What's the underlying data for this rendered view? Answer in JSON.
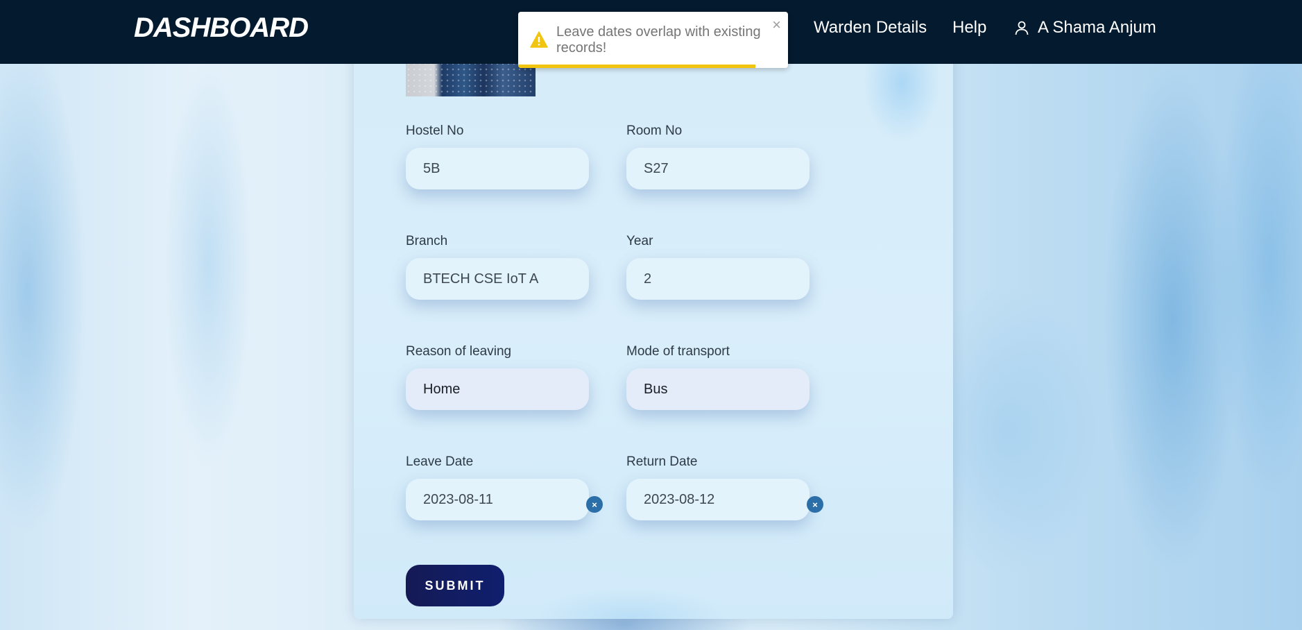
{
  "nav": {
    "brand": "DASHBOARD",
    "links": [
      "Warden Details",
      "Help"
    ],
    "user_name": "A Shama Anjum",
    "user_icon": "user-icon"
  },
  "toast": {
    "message": "Leave dates overlap with existing records!",
    "icon": "warning-icon",
    "close_label": "×",
    "progress": 0.88,
    "accent": "#f1c40f"
  },
  "form": {
    "hostel_no": {
      "label": "Hostel No",
      "value": "5B"
    },
    "room_no": {
      "label": "Room No",
      "value": "S27"
    },
    "branch": {
      "label": "Branch",
      "value": "BTECH CSE IoT A"
    },
    "year": {
      "label": "Year",
      "value": "2"
    },
    "reason": {
      "label": "Reason of leaving",
      "value": "Home"
    },
    "transport": {
      "label": "Mode of transport",
      "value": "Bus"
    },
    "leave_date": {
      "label": "Leave Date",
      "value": "2023-08-11",
      "clear_label": "×"
    },
    "return_date": {
      "label": "Return Date",
      "value": "2023-08-12",
      "clear_label": "×"
    },
    "submit_label": "SUBMIT"
  },
  "colors": {
    "navbar": "#041a2e",
    "submit": "#151a55",
    "clear_button": "#2b6ea8"
  }
}
